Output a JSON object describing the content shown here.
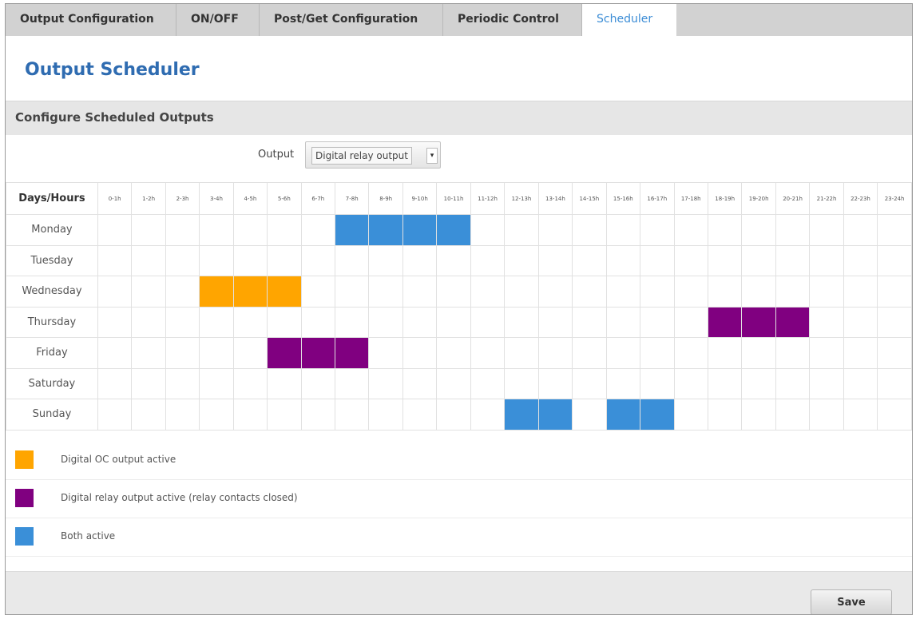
{
  "tabs": [
    {
      "label": "Output Configuration",
      "active": false
    },
    {
      "label": "ON/OFF",
      "active": false
    },
    {
      "label": "Post/Get Configuration",
      "active": false
    },
    {
      "label": "Periodic Control",
      "active": false
    },
    {
      "label": "Scheduler",
      "active": true
    }
  ],
  "page_title": "Output Scheduler",
  "section_title": "Configure Scheduled Outputs",
  "output": {
    "label": "Output",
    "selected": "Digital relay output"
  },
  "table": {
    "corner_label": "Days/Hours",
    "hours": [
      "0-1h",
      "1-2h",
      "2-3h",
      "3-4h",
      "4-5h",
      "5-6h",
      "6-7h",
      "7-8h",
      "8-9h",
      "9-10h",
      "10-11h",
      "11-12h",
      "12-13h",
      "13-14h",
      "14-15h",
      "15-16h",
      "16-17h",
      "17-18h",
      "18-19h",
      "19-20h",
      "20-21h",
      "21-22h",
      "22-23h",
      "23-24h"
    ],
    "days": [
      "Monday",
      "Tuesday",
      "Wednesday",
      "Thursday",
      "Friday",
      "Saturday",
      "Sunday"
    ],
    "schedule": [
      [
        "",
        "",
        "",
        "",
        "",
        "",
        "",
        "both",
        "both",
        "both",
        "both",
        "",
        "",
        "",
        "",
        "",
        "",
        "",
        "",
        "",
        "",
        "",
        "",
        ""
      ],
      [
        "",
        "",
        "",
        "",
        "",
        "",
        "",
        "",
        "",
        "",
        "",
        "",
        "",
        "",
        "",
        "",
        "",
        "",
        "",
        "",
        "",
        "",
        "",
        ""
      ],
      [
        "",
        "",
        "",
        "oc",
        "oc",
        "oc",
        "",
        "",
        "",
        "",
        "",
        "",
        "",
        "",
        "",
        "",
        "",
        "",
        "",
        "",
        "",
        "",
        "",
        ""
      ],
      [
        "",
        "",
        "",
        "",
        "",
        "",
        "",
        "",
        "",
        "",
        "",
        "",
        "",
        "",
        "",
        "",
        "",
        "",
        "relay",
        "relay",
        "relay",
        "",
        "",
        ""
      ],
      [
        "",
        "",
        "",
        "",
        "",
        "relay",
        "relay",
        "relay",
        "",
        "",
        "",
        "",
        "",
        "",
        "",
        "",
        "",
        "",
        "",
        "",
        "",
        "",
        "",
        ""
      ],
      [
        "",
        "",
        "",
        "",
        "",
        "",
        "",
        "",
        "",
        "",
        "",
        "",
        "",
        "",
        "",
        "",
        "",
        "",
        "",
        "",
        "",
        "",
        "",
        ""
      ],
      [
        "",
        "",
        "",
        "",
        "",
        "",
        "",
        "",
        "",
        "",
        "",
        "",
        "both",
        "both",
        "",
        "both",
        "both",
        "",
        "",
        "",
        "",
        "",
        "",
        ""
      ]
    ]
  },
  "colors": {
    "oc": "#ffa500",
    "relay": "#800080",
    "both": "#3a8fd8"
  },
  "legend": [
    {
      "key": "oc",
      "label": "Digital OC output active"
    },
    {
      "key": "relay",
      "label": "Digital relay output active (relay contacts closed)"
    },
    {
      "key": "both",
      "label": "Both active"
    }
  ],
  "save_label": "Save"
}
